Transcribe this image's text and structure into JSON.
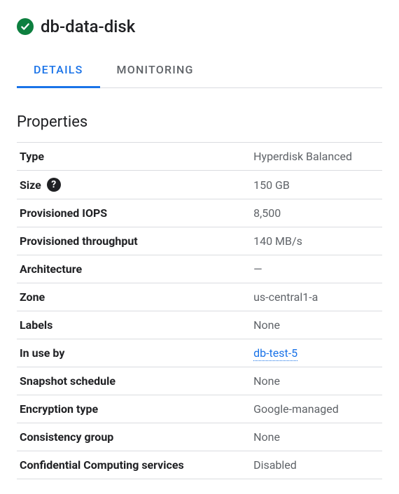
{
  "header": {
    "title": "db-data-disk"
  },
  "tabs": [
    {
      "label": "DETAILS",
      "active": true
    },
    {
      "label": "MONITORING",
      "active": false
    }
  ],
  "section": {
    "title": "Properties"
  },
  "properties": {
    "type": {
      "label": "Type",
      "value": "Hyperdisk Balanced"
    },
    "size": {
      "label": "Size",
      "value": "150 GB"
    },
    "provisioned_iops": {
      "label": "Provisioned IOPS",
      "value": "8,500"
    },
    "provisioned_throughput": {
      "label": "Provisioned throughput",
      "value": "140 MB/s"
    },
    "architecture": {
      "label": "Architecture",
      "value": "—"
    },
    "zone": {
      "label": "Zone",
      "value": "us-central1-a"
    },
    "labels": {
      "label": "Labels",
      "value": "None"
    },
    "in_use_by": {
      "label": "In use by",
      "value": "db-test-5"
    },
    "snapshot_schedule": {
      "label": "Snapshot schedule",
      "value": "None"
    },
    "encryption_type": {
      "label": "Encryption type",
      "value": "Google-managed"
    },
    "consistency_group": {
      "label": "Consistency group",
      "value": "None"
    },
    "confidential_computing": {
      "label": "Confidential Computing services",
      "value": "Disabled"
    }
  },
  "help_tooltip": "?"
}
